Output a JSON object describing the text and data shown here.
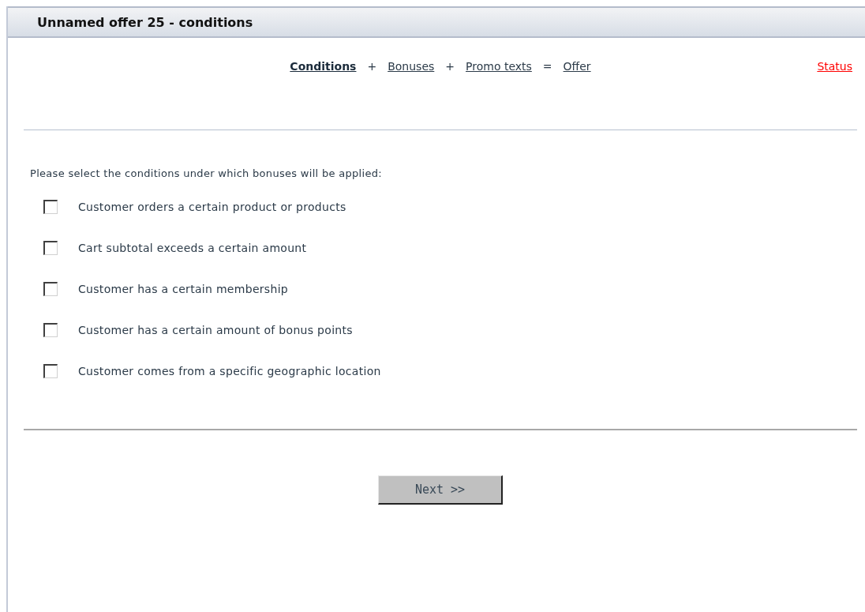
{
  "panel": {
    "title": "Unnamed offer 25 - conditions"
  },
  "steps": [
    {
      "kind": "link",
      "label": "Conditions",
      "selected": true
    },
    {
      "kind": "operator",
      "label": "+"
    },
    {
      "kind": "link",
      "label": "Bonuses",
      "selected": false
    },
    {
      "kind": "operator",
      "label": "+"
    },
    {
      "kind": "link",
      "label": "Promo texts",
      "selected": false
    },
    {
      "kind": "operator",
      "label": "="
    },
    {
      "kind": "link",
      "label": "Offer",
      "selected": false
    }
  ],
  "status_link": "Status",
  "prompt": "Please select the conditions under which bonuses will be applied:",
  "conditions": [
    {
      "label": "Customer orders a certain product or products",
      "checked": false
    },
    {
      "label": "Cart subtotal exceeds a certain amount",
      "checked": false
    },
    {
      "label": "Customer has a certain membership",
      "checked": false
    },
    {
      "label": "Customer has a certain amount of bonus points",
      "checked": false
    },
    {
      "label": "Customer comes from a specific geographic location",
      "checked": false
    }
  ],
  "buttons": {
    "next": "Next >>"
  }
}
